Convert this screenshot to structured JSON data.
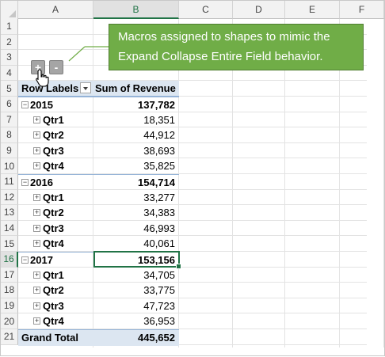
{
  "columns": [
    "A",
    "B",
    "C",
    "D",
    "E",
    "F"
  ],
  "rows": [
    "1",
    "2",
    "3",
    "4",
    "5",
    "6",
    "7",
    "8",
    "9",
    "10",
    "11",
    "12",
    "13",
    "14",
    "15",
    "16",
    "17",
    "18",
    "19",
    "20",
    "21"
  ],
  "selected_column": "B",
  "selected_row": "16",
  "pivot": {
    "header_row_labels": "Row Labels",
    "header_values": "Sum of Revenue",
    "rows": [
      {
        "label": "2015",
        "value": "137,782",
        "type": "year",
        "toggle": "⊟"
      },
      {
        "label": "Qtr1",
        "value": "18,351",
        "type": "qtr",
        "toggle": "⊞"
      },
      {
        "label": "Qtr2",
        "value": "44,912",
        "type": "qtr",
        "toggle": "⊞"
      },
      {
        "label": "Qtr3",
        "value": "38,693",
        "type": "qtr",
        "toggle": "⊞"
      },
      {
        "label": "Qtr4",
        "value": "35,825",
        "type": "qtr",
        "toggle": "⊞"
      },
      {
        "label": "2016",
        "value": "154,714",
        "type": "year",
        "toggle": "⊟"
      },
      {
        "label": "Qtr1",
        "value": "33,277",
        "type": "qtr",
        "toggle": "⊞"
      },
      {
        "label": "Qtr2",
        "value": "34,383",
        "type": "qtr",
        "toggle": "⊞"
      },
      {
        "label": "Qtr3",
        "value": "46,993",
        "type": "qtr",
        "toggle": "⊞"
      },
      {
        "label": "Qtr4",
        "value": "40,061",
        "type": "qtr",
        "toggle": "⊞"
      },
      {
        "label": "2017",
        "value": "153,156",
        "type": "year",
        "toggle": "⊟"
      },
      {
        "label": "Qtr1",
        "value": "34,705",
        "type": "qtr",
        "toggle": "⊞"
      },
      {
        "label": "Qtr2",
        "value": "33,775",
        "type": "qtr",
        "toggle": "⊞"
      },
      {
        "label": "Qtr3",
        "value": "47,723",
        "type": "qtr",
        "toggle": "⊞"
      },
      {
        "label": "Qtr4",
        "value": "36,953",
        "type": "qtr",
        "toggle": "⊞"
      }
    ],
    "grand_total_label": "Grand Total",
    "grand_total_value": "445,652"
  },
  "shapes": {
    "expand_label": "+",
    "collapse_label": "-"
  },
  "callout": {
    "line1": "Macros assigned to shapes to mimic the",
    "line2": "Expand Collapse Entire Field behavior."
  },
  "colors": {
    "accent": "#217346",
    "callout_fill": "#70ad47",
    "pivot_header": "#dce6f1"
  },
  "icons": {
    "cursor": "hand-pointer-icon",
    "expand_toggle": "plus-box-icon",
    "collapse_toggle": "minus-box-icon",
    "filter": "dropdown-arrow-icon"
  }
}
